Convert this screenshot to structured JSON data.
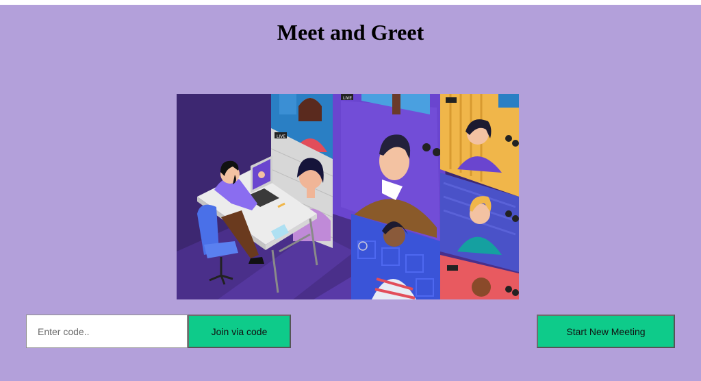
{
  "page": {
    "title": "Meet and Greet"
  },
  "illustration": {
    "icon": "video-conference-illustration",
    "live_tag": "LIVE"
  },
  "join": {
    "placeholder": "Enter code..",
    "value": "",
    "button_label": "Join via code"
  },
  "start": {
    "button_label": "Start New Meeting"
  },
  "colors": {
    "background": "#b3a0da",
    "button": "#0ecb8a",
    "illustration_bg": "#3d2771"
  }
}
